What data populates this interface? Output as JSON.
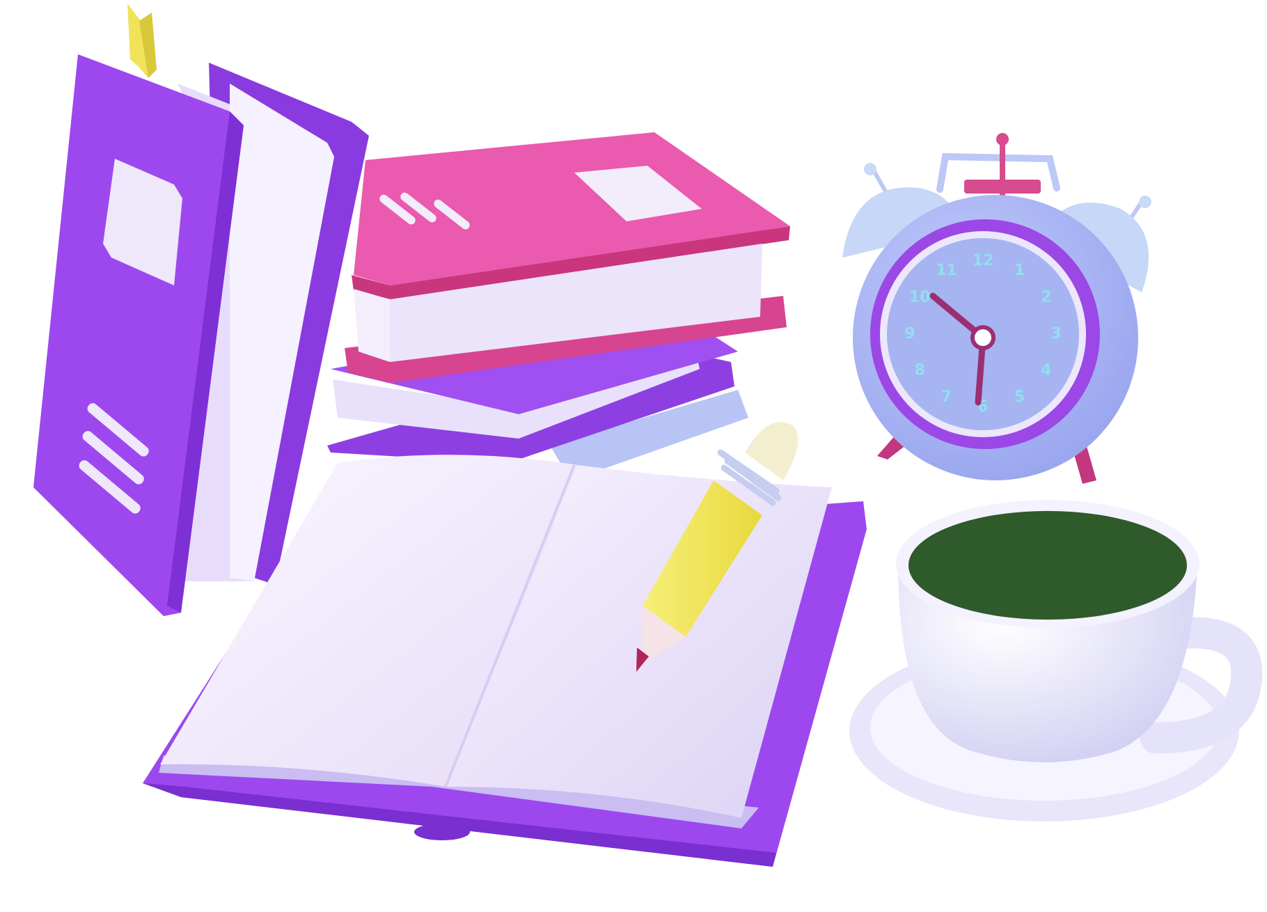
{
  "scene": {
    "objects": [
      "standing-purple-book-icon",
      "stacked-books-icon",
      "open-notebook-icon",
      "pencil-icon",
      "alarm-clock-icon",
      "coffee-cup-icon"
    ]
  },
  "clock": {
    "numerals": [
      "12",
      "1",
      "2",
      "3",
      "4",
      "5",
      "6",
      "7",
      "8",
      "9",
      "10",
      "11"
    ],
    "numeral_color": "#8fe0f0",
    "time_shown": "5:51"
  },
  "colors": {
    "purple": "#9c48ee",
    "purple_dark": "#7a2fd0",
    "magenta": "#e4529f",
    "lavender": "#b9aef0",
    "page": "#efe6fb",
    "clock_body": "#aeb8f4",
    "bell": "#c9daf8",
    "bookmark": "#f0e35a",
    "coffee": "#2f5a2c",
    "cup": "#ecebfb"
  }
}
